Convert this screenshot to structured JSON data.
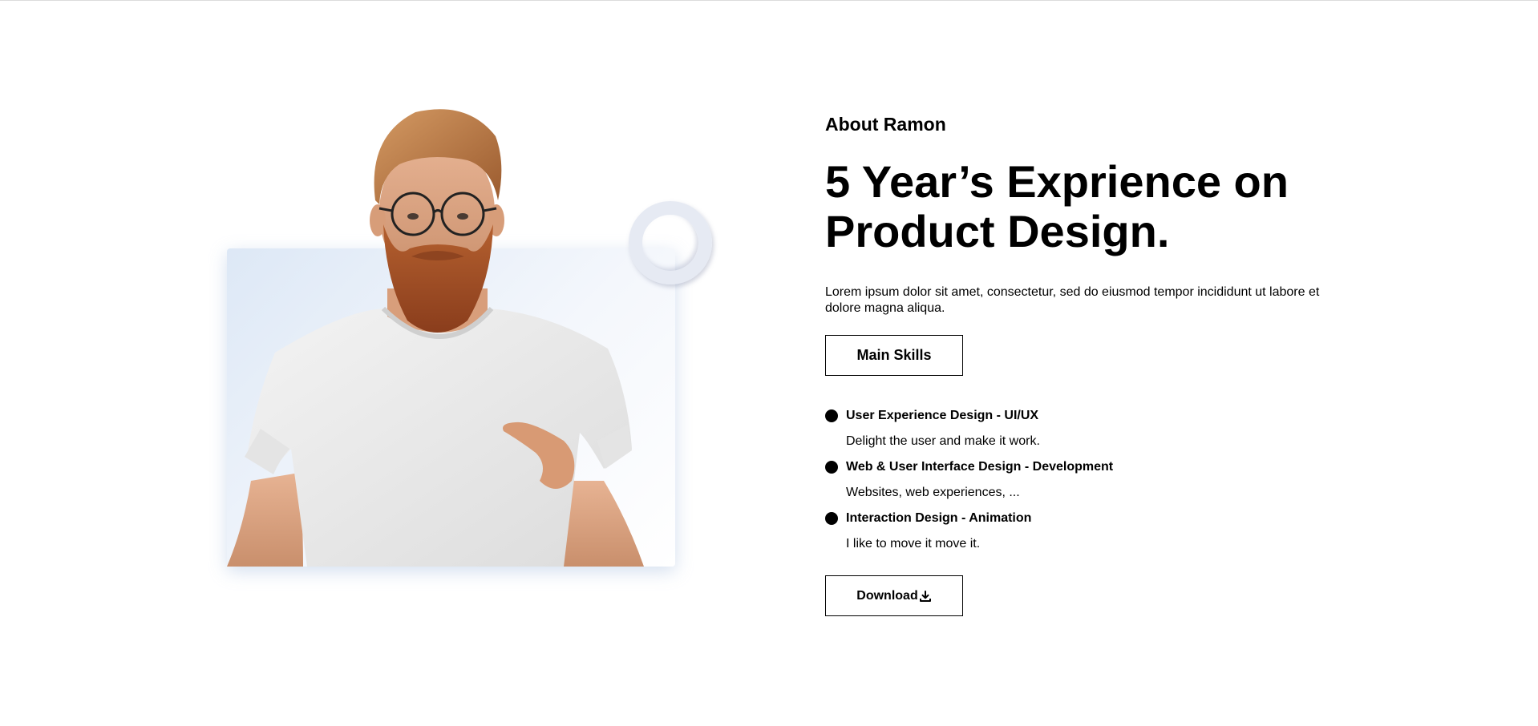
{
  "about": {
    "kicker": "About Ramon",
    "headline": "5 Year’s Exprience on Product Design.",
    "lead": "Lorem ipsum dolor sit amet, consectetur, sed do eiusmod tempor incididunt ut labore et dolore magna aliqua.",
    "skills_button_label": "Main Skills",
    "download_button_label": "Download"
  },
  "skills": [
    {
      "title": "User Experience Design - UI/UX",
      "desc": "Delight the user and make it work."
    },
    {
      "title": "Web & User Interface Design - Development",
      "desc": "Websites, web experiences, ..."
    },
    {
      "title": "Interaction Design - Animation",
      "desc": "I like to move it move it."
    }
  ],
  "icons": {
    "download": "download-icon",
    "bullet": "bullet-dot-icon"
  },
  "colors": {
    "accent_bg_light": "#dde8f6",
    "text": "#000000",
    "ring": "#e6eaf3",
    "beard": "#a4532a",
    "shirt": "#eeeeee"
  }
}
